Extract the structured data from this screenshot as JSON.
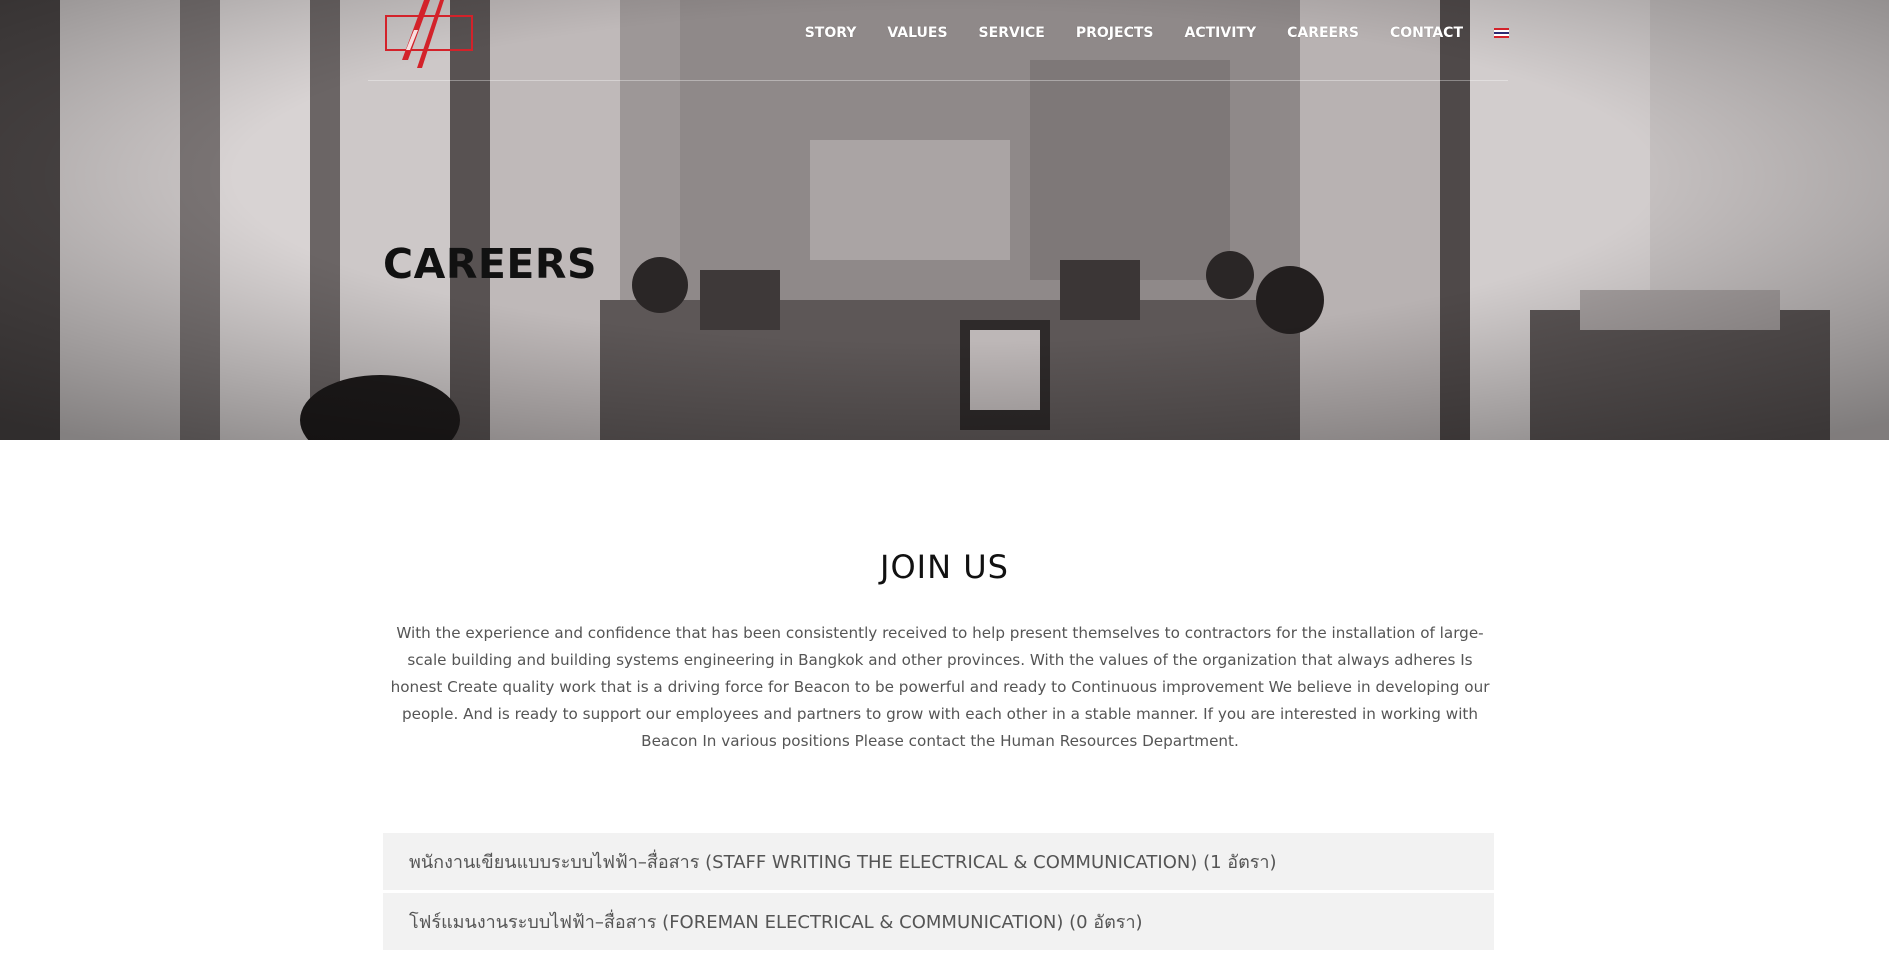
{
  "logo": {
    "name": "beacon-logo",
    "accent": "#d3222a"
  },
  "nav": {
    "items": [
      {
        "label": "STORY"
      },
      {
        "label": "VALUES"
      },
      {
        "label": "SERVICE"
      },
      {
        "label": "PROJECTS"
      },
      {
        "label": "ACTIVITY"
      },
      {
        "label": "CAREERS"
      },
      {
        "label": "CONTACT"
      }
    ],
    "language_flag": "thai-flag-icon"
  },
  "hero": {
    "title": "CAREERS"
  },
  "join": {
    "title": "JOIN US",
    "text": "With the experience and confidence that has been consistently received to help present themselves to contractors for the installation of large-scale building and building systems engineering in Bangkok and other provinces. With the values of the organization that always adheres Is honest Create quality work that is a driving force for Beacon to be powerful and ready to Continuous improvement We believe in developing our people. And is ready to support our employees and partners to grow with each other in a stable manner. If you are interested in working with Beacon In various positions Please contact the Human Resources Department."
  },
  "jobs": [
    {
      "title": "พนักงานเขียนแบบระบบไฟฟ้า–สื่อสาร (STAFF WRITING THE ELECTRICAL & COMMUNICATION) (1 อัตรา)"
    },
    {
      "title": "โฟร์แมนงานระบบไฟฟ้า–สื่อสาร (FOREMAN ELECTRICAL & COMMUNICATION) (0 อัตรา)"
    }
  ],
  "colors": {
    "brand_red": "#d3222a",
    "job_bg": "#f2f2f2",
    "body_text": "#555555"
  }
}
